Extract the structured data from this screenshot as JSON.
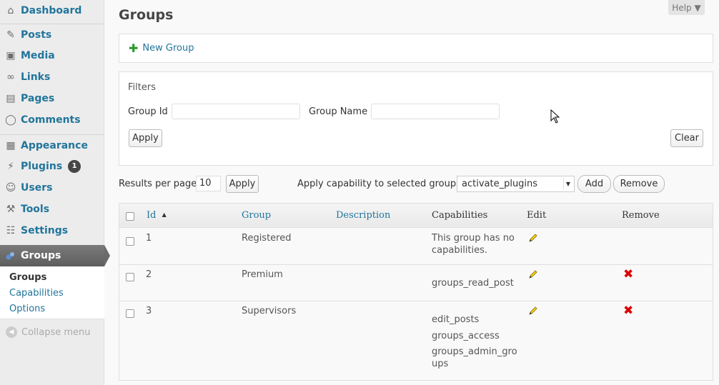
{
  "sidebar": {
    "items": [
      {
        "label": "Dashboard",
        "icon": "dashboard-icon"
      },
      {
        "label": "Posts",
        "icon": "pushpin-icon"
      },
      {
        "label": "Media",
        "icon": "media-icon"
      },
      {
        "label": "Links",
        "icon": "link-icon"
      },
      {
        "label": "Pages",
        "icon": "pages-icon"
      },
      {
        "label": "Comments",
        "icon": "comment-icon"
      },
      {
        "label": "Appearance",
        "icon": "appearance-icon"
      },
      {
        "label": "Plugins",
        "icon": "plug-icon",
        "badge": "1"
      },
      {
        "label": "Users",
        "icon": "users-icon"
      },
      {
        "label": "Tools",
        "icon": "tools-icon"
      },
      {
        "label": "Settings",
        "icon": "settings-icon"
      }
    ],
    "current": {
      "label": "Groups",
      "icon": "groups-icon"
    },
    "submenu": [
      {
        "label": "Groups",
        "current": true
      },
      {
        "label": "Capabilities",
        "current": false
      },
      {
        "label": "Options",
        "current": false
      }
    ],
    "collapse_label": "Collapse menu"
  },
  "header": {
    "title": "Groups",
    "help_label": "Help ▼"
  },
  "new_group": {
    "label": "New Group"
  },
  "filters": {
    "title": "Filters",
    "group_id_label": "Group Id",
    "group_id_value": "",
    "group_name_label": "Group Name",
    "group_name_value": "",
    "apply_label": "Apply",
    "clear_label": "Clear"
  },
  "toolbar": {
    "results_label": "Results per page",
    "results_value": "10",
    "apply_label": "Apply",
    "capability_label": "Apply capability to selected groups:",
    "capability_value": "activate_plugins",
    "add_label": "Add",
    "remove_label": "Remove"
  },
  "table": {
    "columns": {
      "id": "Id",
      "sort_indicator": "▲",
      "group": "Group",
      "description": "Description",
      "capabilities": "Capabilities",
      "edit": "Edit",
      "remove": "Remove"
    },
    "rows": [
      {
        "id": "1",
        "group": "Registered",
        "description": "",
        "capabilities": [
          "This group has no capabilities."
        ],
        "removable": false
      },
      {
        "id": "2",
        "group": "Premium",
        "description": "",
        "capabilities": [
          "groups_read_post"
        ],
        "removable": true
      },
      {
        "id": "3",
        "group": "Supervisors",
        "description": "",
        "capabilities": [
          "edit_posts",
          "groups_access",
          "groups_admin_gro ups"
        ],
        "removable": true
      }
    ]
  },
  "colors": {
    "link": "#21759b",
    "current_menu": "#6b6b6b",
    "remove": "#dd0000",
    "add": "#2e9a2e"
  }
}
